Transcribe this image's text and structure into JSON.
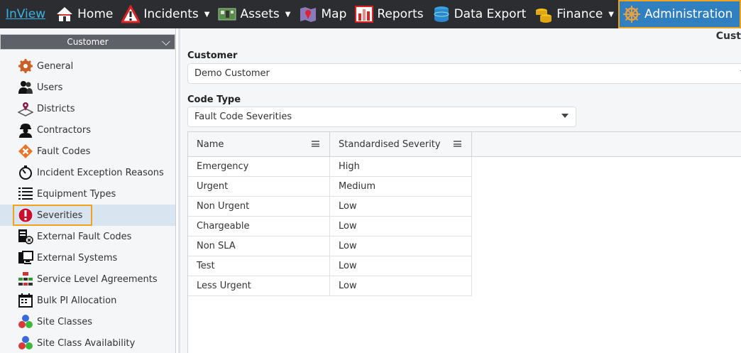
{
  "nav": {
    "brand": "InView",
    "items": [
      {
        "label": "Home",
        "icon": "home-icon"
      },
      {
        "label": "Incidents",
        "icon": "warning-icon",
        "dropdown": true
      },
      {
        "label": "Assets",
        "icon": "circuit-board-icon",
        "dropdown": true
      },
      {
        "label": "Map",
        "icon": "map-pin-icon"
      },
      {
        "label": "Reports",
        "icon": "bar-chart-icon"
      },
      {
        "label": "Data Export",
        "icon": "database-icon"
      },
      {
        "label": "Finance",
        "icon": "coins-icon",
        "dropdown": true
      },
      {
        "label": "Administration",
        "icon": "ship-wheel-icon",
        "active": true
      }
    ]
  },
  "sidebar": {
    "header": "Customer",
    "items": [
      {
        "label": "General",
        "icon": "gear-icon"
      },
      {
        "label": "Users",
        "icon": "users-icon"
      },
      {
        "label": "Districts",
        "icon": "map-pin-icon"
      },
      {
        "label": "Contractors",
        "icon": "worker-icon"
      },
      {
        "label": "Fault Codes",
        "icon": "diamond-x-icon"
      },
      {
        "label": "Incident Exception Reasons",
        "icon": "stopwatch-icon"
      },
      {
        "label": "Equipment Types",
        "icon": "list-icon"
      },
      {
        "label": "Severities",
        "icon": "exclamation-icon",
        "active": true
      },
      {
        "label": "External Fault Codes",
        "icon": "server-x-icon"
      },
      {
        "label": "External Systems",
        "icon": "monitor-icon"
      },
      {
        "label": "Service Level Agreements",
        "icon": "network-icon"
      },
      {
        "label": "Bulk PI Allocation",
        "icon": "calendar-icon"
      },
      {
        "label": "Site Classes",
        "icon": "balls-icon"
      },
      {
        "label": "Site Class Availability",
        "icon": "balls-icon"
      }
    ]
  },
  "main": {
    "title_fragment": "Cust",
    "customer_label": "Customer",
    "customer_value": "Demo Customer",
    "code_type_label": "Code Type",
    "code_type_value": "Fault Code Severities",
    "grid": {
      "columns": [
        "Name",
        "Standardised Severity"
      ],
      "rows": [
        [
          "Emergency",
          "High"
        ],
        [
          "Urgent",
          "Medium"
        ],
        [
          "Non Urgent",
          "Low"
        ],
        [
          "Chargeable",
          "Low"
        ],
        [
          "Non SLA",
          "Low"
        ],
        [
          "Test",
          "Low"
        ],
        [
          "Less Urgent",
          "Low"
        ]
      ]
    }
  },
  "colors": {
    "nav_bg": "#2b2d30",
    "brand": "#3ab3e6",
    "admin_bg": "#2f7fc1",
    "highlight": "#f0a31a",
    "severity_red": "#c8102e"
  }
}
